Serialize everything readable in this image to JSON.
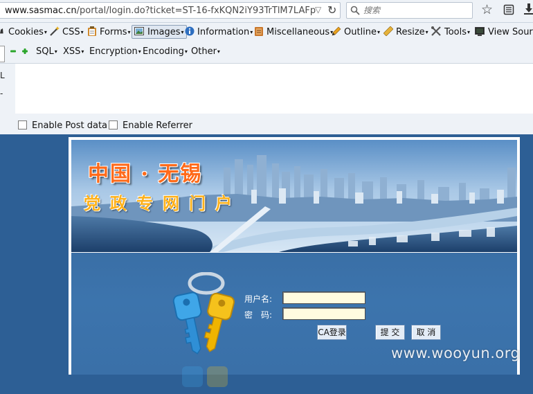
{
  "address_bar": {
    "url_host": "www.sasmac.cn",
    "url_path": "/portal/login.do?ticket=ST-16-fxKQN2iY93TrTlM7LAFp",
    "search_placeholder": "搜索"
  },
  "hackbar_toolbar": {
    "row1": [
      "Cookies",
      "CSS",
      "Forms",
      "Images",
      "Information",
      "Miscellaneous",
      "Outline",
      "Resize",
      "Tools",
      "View Source"
    ],
    "row2": [
      "SQL",
      "XSS",
      "Encryption",
      "Encoding",
      "Other"
    ],
    "side_marks": [
      "L",
      "-"
    ],
    "enable_post": "Enable Post data",
    "enable_referrer": "Enable Referrer"
  },
  "page": {
    "banner_title_1": "中国 · 无锡",
    "banner_title_2": "党政专网门户",
    "username_label": "用户名:",
    "password_label": "密　码:",
    "ca_login": "CA登录",
    "submit": "提 交",
    "cancel": "取 消",
    "watermark": "www.wooyun.org"
  },
  "colors": {
    "page_bg": "#2d5f95",
    "input_bg": "#fffbe0",
    "title_orange": "#ff6a1a",
    "title_yellow": "#ffb11a"
  }
}
